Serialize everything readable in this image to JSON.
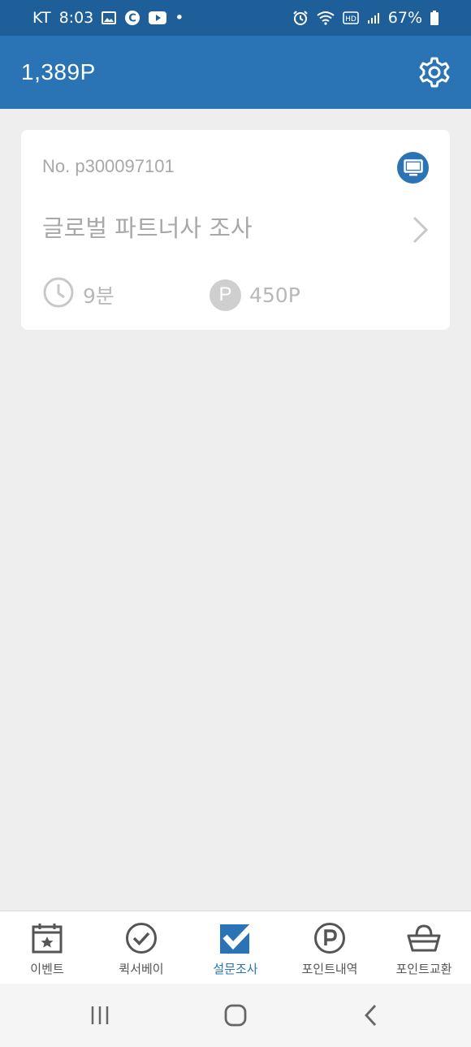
{
  "status_bar": {
    "carrier": "KT",
    "time": "8:03",
    "battery": "67%",
    "dot": "•"
  },
  "header": {
    "points": "1,389P",
    "settings_icon": "gear-icon"
  },
  "survey_card": {
    "number": "No. p300097101",
    "title": "글로벌 파트너사 조사",
    "duration": "9분",
    "reward": "450P",
    "reward_symbol": "P",
    "device_icon": "monitor-icon"
  },
  "bottom_nav": {
    "items": [
      {
        "label": "이벤트",
        "icon": "calendar-star-icon"
      },
      {
        "label": "퀵서베이",
        "icon": "check-circle-icon"
      },
      {
        "label": "설문조사",
        "icon": "checkbox-icon"
      },
      {
        "label": "포인트내역",
        "icon": "point-circle-icon"
      },
      {
        "label": "포인트교환",
        "icon": "basket-icon"
      }
    ],
    "active_index": 2
  },
  "colors": {
    "primary": "#2a74b5",
    "status_bar": "#1f5f99",
    "muted_text": "#a8a8a8",
    "background": "#eeeeee"
  }
}
